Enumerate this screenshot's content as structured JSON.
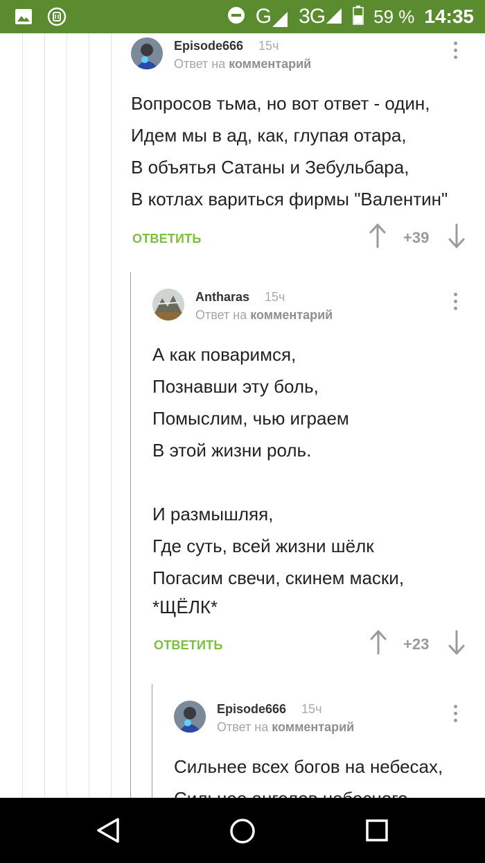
{
  "status_bar": {
    "network_g": "G",
    "network_3g": "3G",
    "network_3g_sup": "3G",
    "battery": "59 %",
    "time": "14:35"
  },
  "comments": [
    {
      "author": "Episode666",
      "time": "15ч",
      "reply_prefix": "Ответ на",
      "reply_target": "комментарий",
      "lines": [
        "Вопросов тьма, но вот ответ - один,",
        "Идем мы в ад, как, глупая отара,",
        "В объятья Сатаны и Зебульбара,",
        "В котлах вариться фирмы \"Валентин\""
      ],
      "reply_label": "ОТВЕТИТЬ",
      "rating": "+39"
    },
    {
      "author": "Antharas",
      "time": "15ч",
      "reply_prefix": "Ответ на",
      "reply_target": "комментарий",
      "lines": [
        "А как поваримся,",
        "Познавши эту боль,",
        "Помыслим, чью играем",
        "В этой жизни роль.",
        "",
        "И размышляя,",
        "Где суть, всей жизни шёлк",
        "Погасим свечи, скинем маски,",
        "*ЩЁЛК*"
      ],
      "reply_label": "ОТВЕТИТЬ",
      "rating": "+23"
    },
    {
      "author": "Episode666",
      "time": "15ч",
      "reply_prefix": "Ответ на",
      "reply_target": "комментарий",
      "lines": [
        "Сильнее всех богов на небесах,",
        "Сильнее ангелов небесного"
      ]
    }
  ],
  "colors": {
    "status_bar": "#5a8c2f",
    "reply_button": "#7bbf3c",
    "rating": "#9a9a9a"
  },
  "icons": {
    "nav_back": "back-triangle-icon",
    "nav_home": "home-circle-icon",
    "nav_recent": "recent-square-icon"
  }
}
